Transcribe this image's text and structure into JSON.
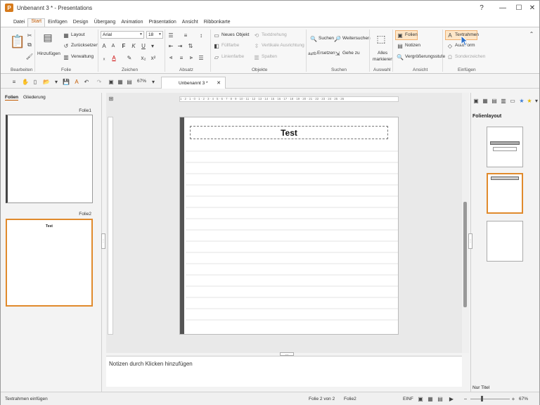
{
  "window": {
    "title": "Unbenannt 3 * - Presentations",
    "app_icon": "P",
    "controls": [
      "?",
      "—",
      "☐",
      "✕"
    ]
  },
  "menu": {
    "items": [
      "Datei",
      "Start",
      "Einfügen",
      "Design",
      "Übergang",
      "Animation",
      "Präsentation",
      "Ansicht",
      "Ribbonkarte"
    ],
    "active": "Start"
  },
  "ribbon": {
    "bearbeiten": {
      "label": "Bearbeiten"
    },
    "folie": {
      "label": "Folie",
      "hinzufuegen": "Hinzufügen",
      "layout": "Layout",
      "zuruecksetzen": "Zurücksetzen",
      "verwaltung": "Verwaltung"
    },
    "zeichen": {
      "label": "Zeichen",
      "font": "Arial",
      "size": "18"
    },
    "absatz": {
      "label": "Absatz"
    },
    "objekte": {
      "label": "Objekte",
      "neues_objekt": "Neues Objekt",
      "fuellfarbe": "Füllfarbe",
      "linienfarbe": "Linienfarbe",
      "textdrehung": "Textdrehung",
      "vertikale_ausrichtung": "Vertikale Ausrichtung",
      "spalten": "Spalten"
    },
    "suchen": {
      "label": "Suchen",
      "suchen": "Suchen",
      "weitersuchen": "Weitersuchen",
      "ersetzen": "Ersetzen",
      "gehe_zu": "Gehe zu"
    },
    "auswahl": {
      "label": "Auswahl",
      "alles": "Alles",
      "markieren": "markieren"
    },
    "ansicht": {
      "label": "Ansicht",
      "folien": "Folien",
      "notizen": "Notizen",
      "vergroesserungsstufe": "Vergrößerungsstufe"
    },
    "einfuegen": {
      "label": "Einfügen",
      "textrahmen": "Textrahmen",
      "autoform": "AutoForm",
      "sonderzeichen": "Sonderzeichen"
    }
  },
  "qat": {
    "zoom": "67%"
  },
  "doctab": {
    "label": "Unbenannt 3 *"
  },
  "left_panel": {
    "tabs": [
      "Folien",
      "Gliederung"
    ],
    "active_tab": "Folien",
    "slides": [
      {
        "label": "Folie1",
        "title": ""
      },
      {
        "label": "Folie2",
        "title": "Test"
      }
    ]
  },
  "ruler": {
    "marks": "1 · 2 · 1 · 0 · 1 · 2 · 3 · 4 · 5 · 6 · 7 · 8 · 9 · 10 · 11 · 12 · 13 · 14 · 15 · 16 · 17 · 18 · 19 · 20 · 21 · 22 · 23 · 24 · 25 · 26"
  },
  "slide": {
    "title": "Test"
  },
  "notes": {
    "placeholder": "Notizen durch Klicken hinzufügen"
  },
  "right_panel": {
    "title": "Folienlayout",
    "footer": "Nur Titel"
  },
  "status": {
    "left": "Textrahmen einfügen",
    "slide_pos": "Folie 2 von 2",
    "slide_name": "Folie2",
    "mode": "EINF",
    "zoom": "67%"
  }
}
